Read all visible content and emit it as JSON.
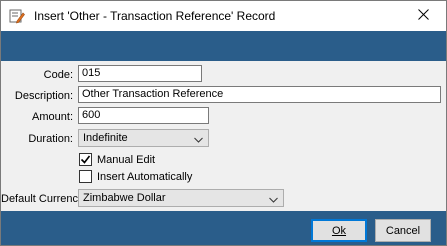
{
  "window": {
    "title": "Insert 'Other - Transaction Reference' Record",
    "icon": "edit-record-icon",
    "close_icon": "close-icon"
  },
  "form": {
    "code": {
      "label": "Code:",
      "value": "015"
    },
    "description": {
      "label": "Description:",
      "value": "Other Transaction Reference"
    },
    "amount": {
      "label": "Amount:",
      "value": "600"
    },
    "duration": {
      "label": "Duration:",
      "value": "Indefinite"
    },
    "manual_edit": {
      "label": "Manual Edit",
      "checked": true
    },
    "insert_automatically": {
      "label": "Insert Automatically",
      "checked": false
    },
    "default_currency": {
      "label": "Default Currency:",
      "value": "Zimbabwe Dollar"
    }
  },
  "buttons": {
    "ok": "Ok",
    "cancel": "Cancel"
  },
  "colors": {
    "band": "#2a5d8a",
    "form_bg": "#f0f0f0",
    "default_button_border": "#0078d7"
  }
}
